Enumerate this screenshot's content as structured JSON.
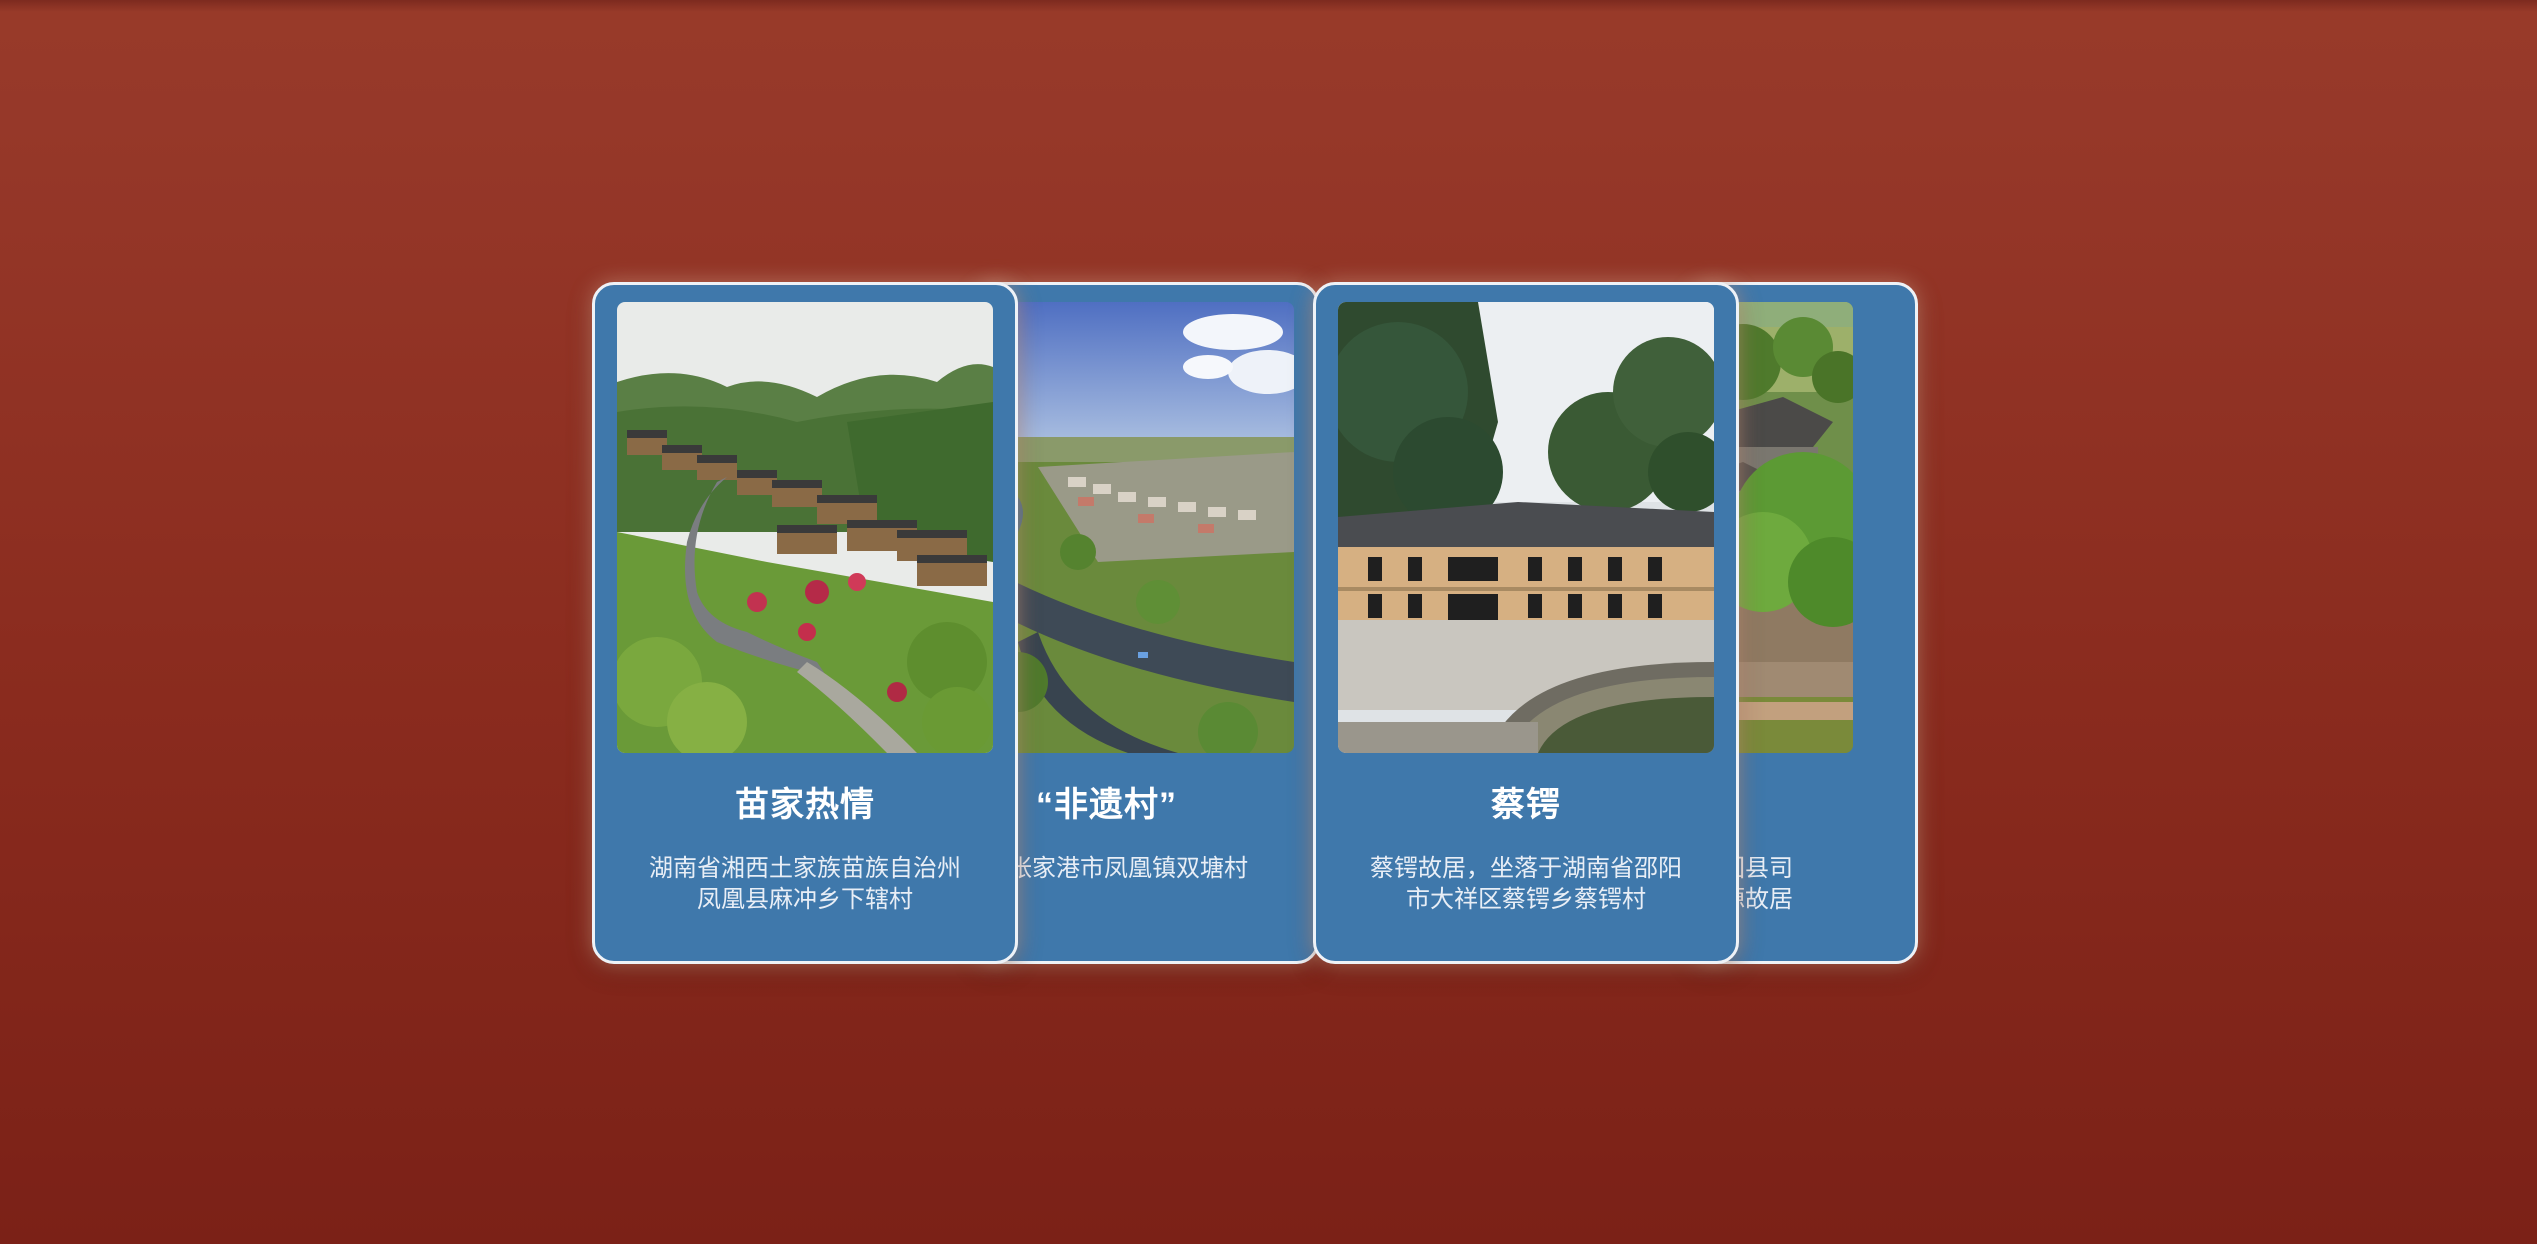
{
  "cards": [
    {
      "title": "苗家热情",
      "desc_line1": "湖南省湘西土家族苗族自治州",
      "desc_line2": "凤凰县麻冲乡下辖村",
      "image": "mountain-village-photo"
    },
    {
      "title": "“非遗村”",
      "desc_line1": "张家港市凤凰镇双塘村",
      "image": "river-town-road-photo"
    },
    {
      "title": "蔡锷",
      "desc_line1": "蔡锷故居，坐落于湖南省邵阳",
      "desc_line2": "市大祥区蔡锷乡蔡锷村",
      "image": "historic-residence-photo"
    },
    {
      "desc_line1": "市隆回县司",
      "desc_line2": "的魏源故居",
      "image": "old-house-garden-photo"
    }
  ],
  "colors": {
    "background": "#8f2f22",
    "card": "#3f78ab",
    "card_border": "#eef2f7",
    "text": "#ffffff"
  }
}
